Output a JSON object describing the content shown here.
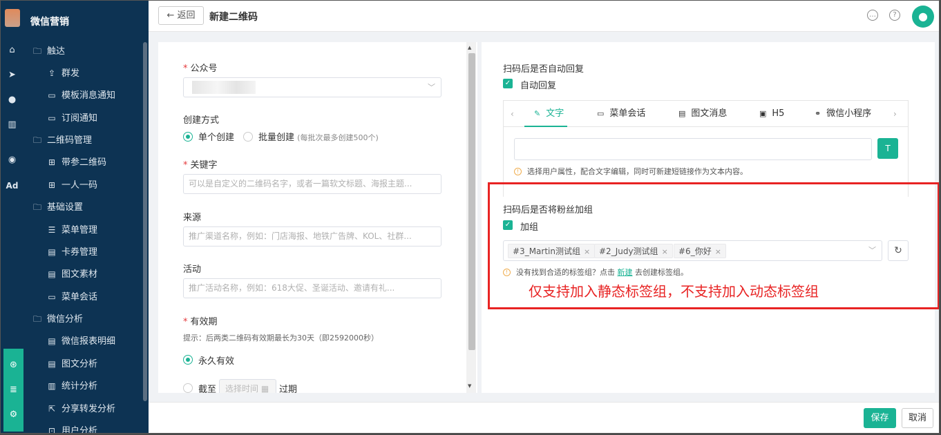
{
  "app": {
    "name": "微信营销",
    "rail_ad_label": "Ad"
  },
  "sidebar": {
    "groups": [
      {
        "label": "触达",
        "items": [
          "群发",
          "模板消息通知",
          "订阅通知"
        ]
      },
      {
        "label": "二维码管理",
        "items": [
          "带参二维码",
          "一人一码"
        ]
      },
      {
        "label": "基础设置",
        "items": [
          "菜单管理",
          "卡券管理",
          "图文素材",
          "菜单会话"
        ]
      },
      {
        "label": "微信分析",
        "items": [
          "微信报表明细",
          "图文分析",
          "统计分析",
          "分享转发分析",
          "用户分析"
        ]
      }
    ]
  },
  "header": {
    "back_label": "返回",
    "title": "新建二维码"
  },
  "form": {
    "account": {
      "label": "公众号"
    },
    "create_mode": {
      "label": "创建方式",
      "single": "单个创建",
      "batch": "批量创建",
      "batch_note": "(每批次最多创建500个)",
      "selected": "单个创建"
    },
    "keyword": {
      "label": "关键字",
      "placeholder": "可以是自定义的二维码名字，或者一篇软文标题、海报主题..."
    },
    "source": {
      "label": "来源",
      "placeholder": "推广渠道名称，例如：门店海报、地铁广告牌、KOL、社群..."
    },
    "campaign": {
      "label": "活动",
      "placeholder": "推广活动名称，例如：618大促、圣诞活动、邀请有礼..."
    },
    "validity": {
      "label": "有效期",
      "hint": "提示：后两类二维码有效期最长为30天（即2592000秒）",
      "permanent": "永久有效",
      "until_prefix": "截至",
      "until_placeholder": "选择时间",
      "until_suffix": "过期",
      "selected": "永久有效"
    }
  },
  "auto_reply": {
    "title": "扫码后是否自动回复",
    "checkbox_label": "自动回复",
    "checked": true,
    "tabs": [
      "文字",
      "菜单会话",
      "图文消息",
      "H5",
      "微信小程序"
    ],
    "active_tab": "文字",
    "note": "选择用户属性，配合文字编辑，同时可新建短链接作为文本内容。"
  },
  "group": {
    "title": "扫码后是否将粉丝加组",
    "checkbox_label": "加组",
    "checked": true,
    "tags": [
      "#3_Martin测试组",
      "#2_Judy测试组",
      "#6_你好"
    ],
    "note_prefix": "没有找到合适的标签组？点击",
    "note_link": "新建",
    "note_suffix": "去创建标签组。"
  },
  "annotation": {
    "text": "仅支持加入静态标签组，不支持加入动态标签组",
    "color": "#e82323"
  },
  "footer": {
    "save_label": "保存",
    "cancel_label": "取消"
  },
  "colors": {
    "accent": "#1ab394",
    "sidebar_bg": "#0d3353",
    "required": "#e4393c"
  }
}
